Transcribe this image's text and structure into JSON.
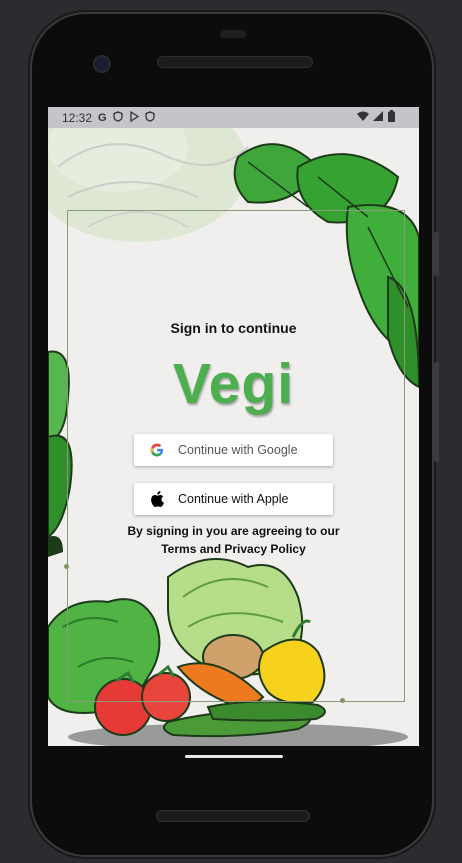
{
  "status_bar": {
    "time": "12:32",
    "left_icons": [
      "google-g-icon",
      "shield-icon",
      "play-icon",
      "shield-icon"
    ],
    "right_icons": [
      "wifi-icon",
      "signal-icon",
      "battery-icon"
    ]
  },
  "auth": {
    "heading": "Sign in to continue",
    "app_name": "Vegi",
    "google_label": "Continue with Google",
    "apple_label": "Continue with Apple",
    "agreement_line1": "By signing in you are agreeing to our",
    "agreement_line2": "Terms and Privacy Policy"
  },
  "colors": {
    "brand_green": "#4cae4f",
    "frame_line": "#8a9b78",
    "screen_bg": "#f0efed"
  }
}
